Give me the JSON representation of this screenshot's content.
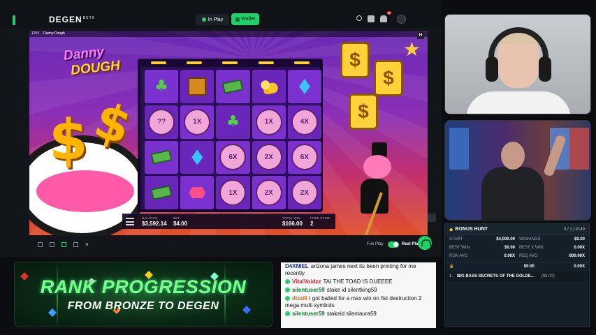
{
  "header": {
    "logo": "DEGEN",
    "logo_sup": "BETA",
    "in_play": "In Play",
    "wallet": "Wallet",
    "notification_count": "95"
  },
  "game": {
    "topbar_id": "1256",
    "topbar_title": "Danny Dough",
    "title_line1": "Danny",
    "title_line2": "DOUGH",
    "corner_badge": "H",
    "hud": {
      "balance_label": "BALANCE",
      "balance": "$3,592.14",
      "bet_label": "BET",
      "bet": "$4.00",
      "total_win_label": "TOTAL WIN",
      "total_win": "$166.00",
      "free_spins_label": "FREE SPINS",
      "free_spins": "2"
    },
    "grid": [
      [
        "clover",
        "crate",
        "cash",
        "coins",
        "gem"
      ],
      [
        "pig:??",
        "pig:1X",
        "clover",
        "pig:1X",
        "pig:4X"
      ],
      [
        "cash",
        "gem",
        "pig:6X",
        "pig:2X",
        "pig:6X"
      ],
      [
        "cash",
        "ruby",
        "pig:1X",
        "pig:2X",
        "pig:2X"
      ]
    ]
  },
  "footer": {
    "fun_play": "Fun Play",
    "real_play": "Real Play"
  },
  "bonus_hunt": {
    "title": "BONUS HUNT",
    "count": "0 / 1 | #149",
    "rows": [
      {
        "l1": "START",
        "v1": "$4,000.00",
        "l2": "WINNINGS",
        "v2": "$0.00"
      },
      {
        "l1": "BEST WIN",
        "v1": "$0.00",
        "l2": "BEST X WIN",
        "v2": "0.00X"
      },
      {
        "l1": "RUN AVG",
        "v1": "0.00X",
        "l2": "REQ AVG",
        "v2": "800.00X"
      }
    ],
    "crown_row": {
      "v1": "$0.00",
      "v2": "0.00X"
    },
    "slot": {
      "index": "1.",
      "name": "BIG BASS SECRETS OF THE GOLDE...",
      "amount": "($5.00)"
    }
  },
  "rank_banner": {
    "line1": "RANK PROGRESSION",
    "line2": "FROM BRONZE TO DEGEN"
  },
  "chat": [
    {
      "user": "D4XNIEL",
      "text": "arizona james next its been printing for me recently",
      "color": "#1f2d8a",
      "badge": ""
    },
    {
      "user": "VitalVoidzz",
      "text": "TAI THE TOAD IS DUEEEE",
      "color": "#e0232e",
      "badge": "#2ecc71"
    },
    {
      "user": "silentuser59",
      "text": "stake id silentking59",
      "color": "#0d7d2f",
      "badge": "#2ecc71"
    },
    {
      "user": "dizzili",
      "text": "i got baited for a max win on fist destruction 2 mega multi symbols",
      "color": "#d2691e",
      "badge": "#2ecc71"
    },
    {
      "user": "silentuser59",
      "text": "stakeid silentaura59",
      "color": "#0d7d2f",
      "badge": "#2ecc71"
    }
  ]
}
